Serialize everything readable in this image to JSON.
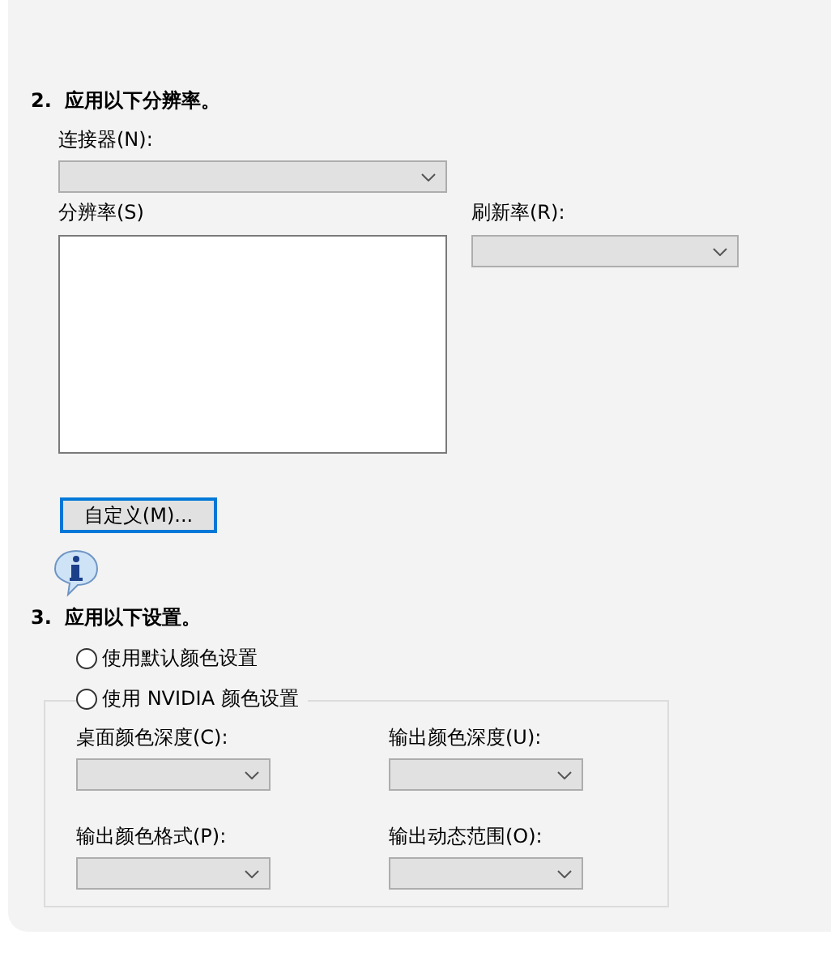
{
  "section_2": {
    "number": "2.",
    "title": "应用以下分辨率。",
    "connector": {
      "label": "连接器(N):",
      "disabled": true
    },
    "resolution": {
      "label": "分辨率(S)"
    },
    "refresh_rate": {
      "label": "刷新率(R):",
      "disabled": true
    },
    "customize_button": "自定义(M)..."
  },
  "section_3": {
    "number": "3.",
    "title": "应用以下设置。",
    "options": [
      {
        "label": "使用默认颜色设置",
        "selected": false
      },
      {
        "label": "使用 NVIDIA 颜色设置",
        "selected": false
      }
    ],
    "fields": [
      {
        "label": "桌面颜色深度(C):",
        "disabled": true
      },
      {
        "label": "输出颜色深度(U):",
        "disabled": true
      },
      {
        "label": "输出颜色格式(P):",
        "disabled": true
      },
      {
        "label": "输出动态范围(O):",
        "disabled": true
      }
    ]
  }
}
